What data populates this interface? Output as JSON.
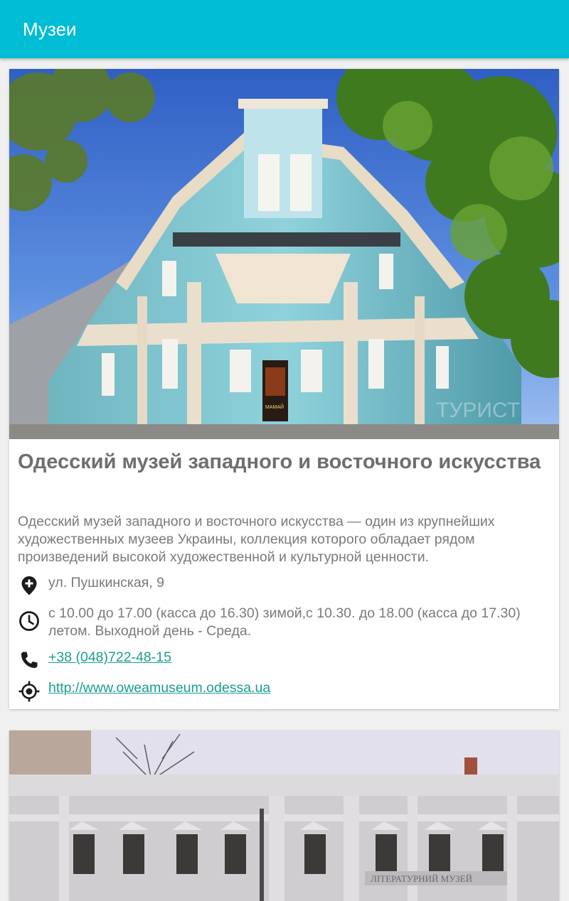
{
  "app_bar": {
    "title": "Музеи"
  },
  "museums": [
    {
      "title": "Одесский музей западного и восточного искусства",
      "description": "Одесский музей западного и восточного искусства — один из крупнейших художественных музеев Украины, коллекция которого обладает рядом произведений высокой художественной и культурной ценности.",
      "address": "ул. Пушкинская, 9",
      "hours": "с 10.00 до 17.00 (касса до 16.30) зимой,с 10.30. до 18.00 (касса до 17.30) летом. Выходной день - Среда.",
      "phone": "+38 (048)722-48-15",
      "website": "http://www.oweamuseum.odessa.ua",
      "photo_caption": "ТУРИСТ",
      "poster_text": "МАМАЙ"
    },
    {
      "building_sign": "ЛІТЕРАТУРНИЙ МУЗЕЙ"
    }
  ],
  "icons": {
    "address": "location-pin-icon",
    "hours": "clock-icon",
    "phone": "phone-icon",
    "website": "target-icon"
  },
  "colors": {
    "app_bar": "#00bcd4",
    "link": "#1a9e8e",
    "title_text": "#6e6e6e",
    "body_text": "#7a7a7a",
    "background": "#f0f0f0"
  }
}
